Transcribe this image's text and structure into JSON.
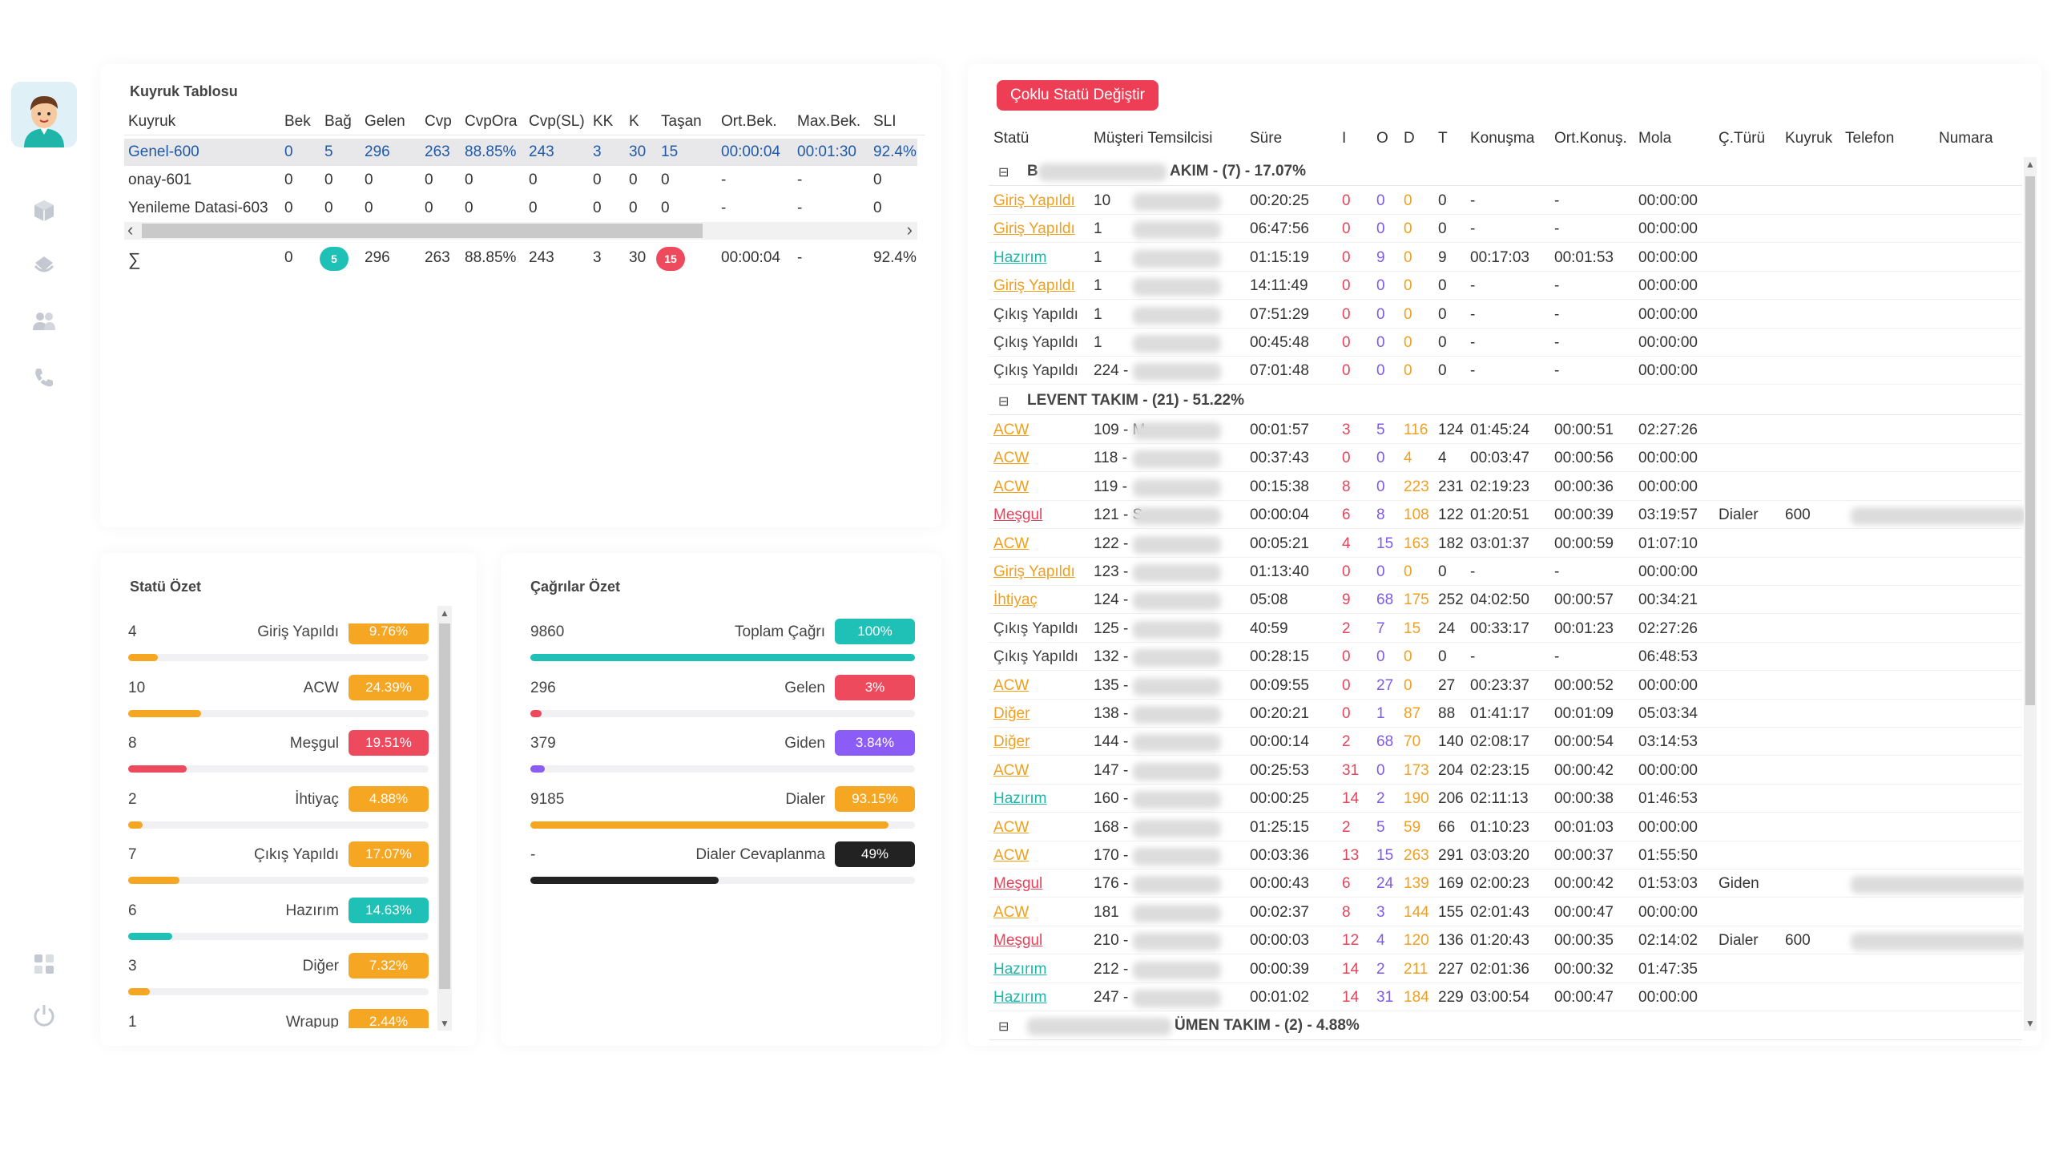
{
  "sidebar": {
    "icons": [
      "cube-icon",
      "bucket-icon",
      "users-icon",
      "phone-icon",
      "grid-icon",
      "power-icon"
    ]
  },
  "kuyruk": {
    "title": "Kuyruk Tablosu",
    "columns": [
      "Kuyruk",
      "Bek",
      "Bağ",
      "Gelen",
      "Cvp",
      "CvpOra",
      "Cvp(SL)",
      "KK",
      "K",
      "Taşan",
      "Ort.Bek.",
      "Max.Bek.",
      "SLI"
    ],
    "rows": [
      [
        "Genel-600",
        "0",
        "5",
        "296",
        "263",
        "88.85%",
        "243",
        "3",
        "30",
        "15",
        "00:00:04",
        "00:01:30",
        "92.4%"
      ],
      [
        "onay-601",
        "0",
        "0",
        "0",
        "0",
        "0",
        "0",
        "0",
        "0",
        "0",
        "-",
        "-",
        "0"
      ],
      [
        "Yenileme Datasi-603",
        "0",
        "0",
        "0",
        "0",
        "0",
        "0",
        "0",
        "0",
        "0",
        "-",
        "-",
        "0"
      ]
    ],
    "totals": [
      "∑",
      "0",
      "5",
      "296",
      "263",
      "88.85%",
      "243",
      "3",
      "30",
      "15",
      "00:00:04",
      "-",
      "92.4%"
    ]
  },
  "statu_ozet": {
    "title": "Statü Özet",
    "items": [
      {
        "count": "4",
        "label": "Giriş Yapıldı",
        "pct": "9.76%",
        "value": 9.76,
        "color": "#f5a623"
      },
      {
        "count": "10",
        "label": "ACW",
        "pct": "24.39%",
        "value": 24.39,
        "color": "#f5a623"
      },
      {
        "count": "8",
        "label": "Meşgul",
        "pct": "19.51%",
        "value": 19.51,
        "color": "#ee4a5d"
      },
      {
        "count": "2",
        "label": "İhtiyaç",
        "pct": "4.88%",
        "value": 4.88,
        "color": "#f5a623"
      },
      {
        "count": "7",
        "label": "Çıkış Yapıldı",
        "pct": "17.07%",
        "value": 17.07,
        "color": "#f5a623"
      },
      {
        "count": "6",
        "label": "Hazırım",
        "pct": "14.63%",
        "value": 14.63,
        "color": "#1fc1b6"
      },
      {
        "count": "3",
        "label": "Diğer",
        "pct": "7.32%",
        "value": 7.32,
        "color": "#f5a623"
      },
      {
        "count": "1",
        "label": "Wrapup",
        "pct": "2.44%",
        "value": 2.44,
        "color": "#f5a623"
      }
    ]
  },
  "cagrilar_ozet": {
    "title": "Çağrılar Özet",
    "items": [
      {
        "count": "9860",
        "label": "Toplam Çağrı",
        "pct": "100%",
        "value": 100,
        "color": "#1fc1b6"
      },
      {
        "count": "296",
        "label": "Gelen",
        "pct": "3%",
        "value": 3,
        "color": "#ee4a5d"
      },
      {
        "count": "379",
        "label": "Giden",
        "pct": "3.84%",
        "value": 3.84,
        "color": "#8b5cf6"
      },
      {
        "count": "9185",
        "label": "Dialer",
        "pct": "93.15%",
        "value": 93.15,
        "color": "#f5a623"
      },
      {
        "count": "-",
        "label": "Dialer Cevaplanma",
        "pct": "49%",
        "value": 49,
        "color": "#222222"
      }
    ]
  },
  "agents": {
    "button_label": "Çoklu Statü Değiştir",
    "columns": [
      "Statü",
      "Müşteri Temsilcisi",
      "Süre",
      "I",
      "O",
      "D",
      "T",
      "Konuşma",
      "Ort.Konuş.",
      "Mola",
      "Ç.Türü",
      "Kuyruk",
      "Telefon",
      "Numara"
    ],
    "groups": [
      {
        "title_a": "B",
        "title_b": "AKIM - (7) - 17.07%"
      },
      {
        "title_a": "LEVENT TAKIM - (21) - 51.22%",
        "title_b": ""
      },
      {
        "title_a": "",
        "title_b": "ÜMEN TAKIM - (2) - 4.88%"
      }
    ],
    "rows_g1": [
      [
        "Giriş Yapıldı",
        "10",
        "00:20:25",
        "0",
        "0",
        "0",
        "0",
        "-",
        "-",
        "00:00:00",
        "",
        ""
      ],
      [
        "Giriş Yapıldı",
        "1",
        "06:47:56",
        "0",
        "0",
        "0",
        "0",
        "-",
        "-",
        "00:00:00",
        "",
        ""
      ],
      [
        "Hazırım",
        "1",
        "01:15:19",
        "0",
        "9",
        "0",
        "9",
        "00:17:03",
        "00:01:53",
        "00:00:00",
        "",
        ""
      ],
      [
        "Giriş Yapıldı",
        "1",
        "14:11:49",
        "0",
        "0",
        "0",
        "0",
        "-",
        "-",
        "00:00:00",
        "",
        ""
      ],
      [
        "Çıkış Yapıldı",
        "1",
        "07:51:29",
        "0",
        "0",
        "0",
        "0",
        "-",
        "-",
        "00:00:00",
        "",
        ""
      ],
      [
        "Çıkış Yapıldı",
        "1",
        "00:45:48",
        "0",
        "0",
        "0",
        "0",
        "-",
        "-",
        "00:00:00",
        "",
        ""
      ],
      [
        "Çıkış Yapıldı",
        "224 -",
        "07:01:48",
        "0",
        "0",
        "0",
        "0",
        "-",
        "-",
        "00:00:00",
        "",
        ""
      ]
    ],
    "rows_g2": [
      [
        "ACW",
        "109 - M",
        "00:01:57",
        "3",
        "5",
        "116",
        "124",
        "01:45:24",
        "00:00:51",
        "02:27:26",
        "",
        ""
      ],
      [
        "ACW",
        "118 -",
        "00:37:43",
        "0",
        "0",
        "4",
        "4",
        "00:03:47",
        "00:00:56",
        "00:00:00",
        "",
        ""
      ],
      [
        "ACW",
        "119 -",
        "00:15:38",
        "8",
        "0",
        "223",
        "231",
        "02:19:23",
        "00:00:36",
        "00:00:00",
        "",
        ""
      ],
      [
        "Meşgul",
        "121 - S",
        "00:00:04",
        "6",
        "8",
        "108",
        "122",
        "01:20:51",
        "00:00:39",
        "03:19:57",
        "Dialer",
        "600"
      ],
      [
        "ACW",
        "122 -",
        "00:05:21",
        "4",
        "15",
        "163",
        "182",
        "03:01:37",
        "00:00:59",
        "01:07:10",
        "",
        ""
      ],
      [
        "Giriş Yapıldı",
        "123 -",
        "01:13:40",
        "0",
        "0",
        "0",
        "0",
        "-",
        "-",
        "00:00:00",
        "",
        ""
      ],
      [
        "İhtiyaç",
        "124 -",
        "05:08",
        "9",
        "68",
        "175",
        "252",
        "04:02:50",
        "00:00:57",
        "00:34:21",
        "",
        ""
      ],
      [
        "Çıkış Yapıldı",
        "125 -",
        "40:59",
        "2",
        "7",
        "15",
        "24",
        "00:33:17",
        "00:01:23",
        "02:27:26",
        "",
        ""
      ],
      [
        "Çıkış Yapıldı",
        "132 -",
        "00:28:15",
        "0",
        "0",
        "0",
        "0",
        "-",
        "-",
        "06:48:53",
        "",
        ""
      ],
      [
        "ACW",
        "135 -",
        "00:09:55",
        "0",
        "27",
        "0",
        "27",
        "00:23:37",
        "00:00:52",
        "00:00:00",
        "",
        ""
      ],
      [
        "Diğer",
        "138 -",
        "00:20:21",
        "0",
        "1",
        "87",
        "88",
        "01:41:17",
        "00:01:09",
        "05:03:34",
        "",
        ""
      ],
      [
        "Diğer",
        "144 -",
        "00:00:14",
        "2",
        "68",
        "70",
        "140",
        "02:08:17",
        "00:00:54",
        "03:14:53",
        "",
        ""
      ],
      [
        "ACW",
        "147 -",
        "00:25:53",
        "31",
        "0",
        "173",
        "204",
        "02:23:15",
        "00:00:42",
        "00:00:00",
        "",
        ""
      ],
      [
        "Hazırım",
        "160 -",
        "00:00:25",
        "14",
        "2",
        "190",
        "206",
        "02:11:13",
        "00:00:38",
        "01:46:53",
        "",
        ""
      ],
      [
        "ACW",
        "168 -",
        "01:25:15",
        "2",
        "5",
        "59",
        "66",
        "01:10:23",
        "00:01:03",
        "00:00:00",
        "",
        ""
      ],
      [
        "ACW",
        "170 -",
        "00:03:36",
        "13",
        "15",
        "263",
        "291",
        "03:03:20",
        "00:00:37",
        "01:55:50",
        "",
        ""
      ],
      [
        "Meşgul",
        "176 -",
        "00:00:43",
        "6",
        "24",
        "139",
        "169",
        "02:00:23",
        "00:00:42",
        "01:53:03",
        "Giden",
        ""
      ],
      [
        "ACW",
        "181",
        "00:02:37",
        "8",
        "3",
        "144",
        "155",
        "02:01:43",
        "00:00:47",
        "00:00:00",
        "",
        ""
      ],
      [
        "Meşgul",
        "210 -",
        "00:00:03",
        "12",
        "4",
        "120",
        "136",
        "01:20:43",
        "00:00:35",
        "02:14:02",
        "Dialer",
        "600"
      ],
      [
        "Hazırım",
        "212 -",
        "00:00:39",
        "14",
        "2",
        "211",
        "227",
        "02:01:36",
        "00:00:32",
        "01:47:35",
        "",
        ""
      ],
      [
        "Hazırım",
        "247 -",
        "00:01:02",
        "14",
        "31",
        "184",
        "229",
        "03:00:54",
        "00:00:47",
        "00:00:00",
        "",
        ""
      ]
    ]
  }
}
